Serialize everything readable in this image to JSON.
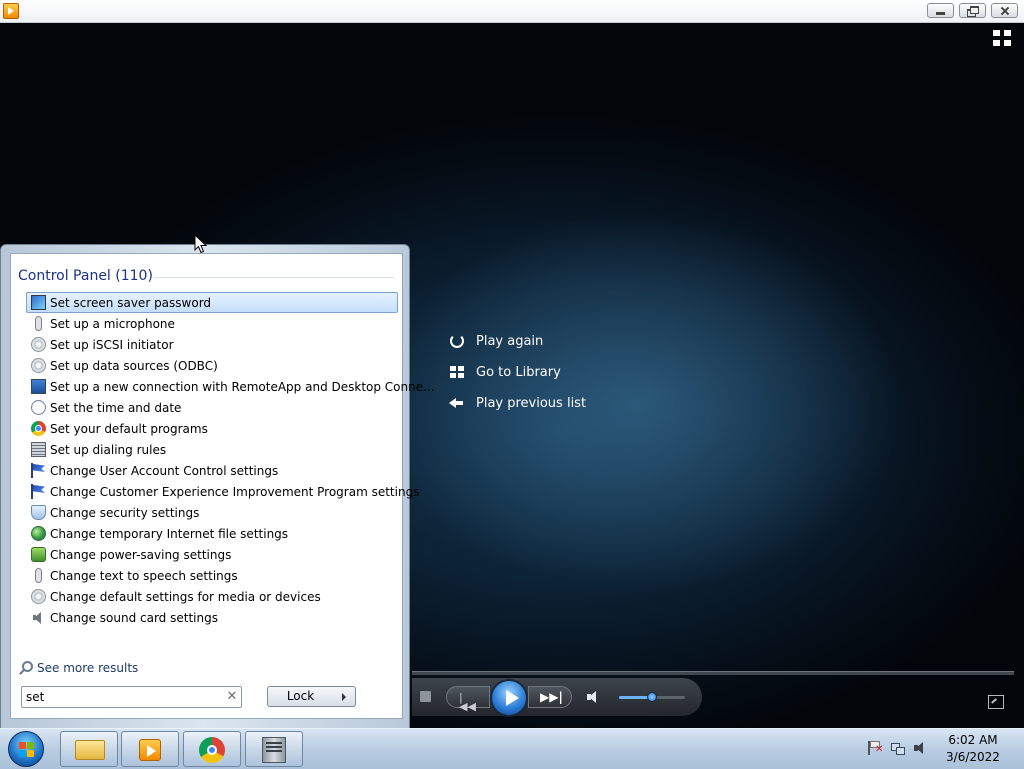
{
  "window": {
    "app_icon": "media-player-icon",
    "controls": [
      "minimize",
      "restore",
      "close"
    ]
  },
  "player": {
    "playback_options": [
      {
        "label": "Play again",
        "icon": "replay-icon"
      },
      {
        "label": "Go to Library",
        "icon": "library-icon"
      },
      {
        "label": "Play previous list",
        "icon": "back-arrow-icon"
      }
    ],
    "controls": {
      "stop": "stop-icon",
      "previous": "previous-icon",
      "play": "play-icon",
      "next": "next-icon",
      "mute": "speaker-icon",
      "volume_fraction": 0.5,
      "fullscreen": "fullscreen-icon"
    },
    "accent": "#2d7fd8"
  },
  "start_menu": {
    "section_header": "Control Panel (110)",
    "results": [
      {
        "label": "Set screen saver password",
        "icon": "monitor-icon",
        "selected": true
      },
      {
        "label": "Set up a microphone",
        "icon": "microphone-icon"
      },
      {
        "label": "Set up iSCSI initiator",
        "icon": "gear-icon"
      },
      {
        "label": "Set up data sources (ODBC)",
        "icon": "gear-icon"
      },
      {
        "label": "Set up a new connection with RemoteApp and Desktop Conne...",
        "icon": "remote-desktop-icon"
      },
      {
        "label": "Set the time and date",
        "icon": "clock-icon"
      },
      {
        "label": "Set your default programs",
        "icon": "chrome-icon"
      },
      {
        "label": "Set up dialing rules",
        "icon": "phone-icon"
      },
      {
        "label": "Change User Account Control settings",
        "icon": "flag-icon"
      },
      {
        "label": "Change Customer Experience Improvement Program settings",
        "icon": "flag-icon"
      },
      {
        "label": "Change security settings",
        "icon": "shield-icon"
      },
      {
        "label": "Change temporary Internet file settings",
        "icon": "globe-icon"
      },
      {
        "label": "Change power-saving settings",
        "icon": "power-icon"
      },
      {
        "label": "Change text to speech settings",
        "icon": "microphone-icon"
      },
      {
        "label": "Change default settings for media or devices",
        "icon": "gear-icon"
      },
      {
        "label": "Change sound card settings",
        "icon": "speaker-icon"
      }
    ],
    "see_more": "See more results",
    "search": {
      "value": "set",
      "placeholder": ""
    },
    "power_button": {
      "label": "Lock"
    }
  },
  "taskbar": {
    "pinned": [
      {
        "name": "Windows Explorer",
        "icon": "folder-icon"
      },
      {
        "name": "Windows Media Player",
        "icon": "media-player-icon"
      },
      {
        "name": "Google Chrome",
        "icon": "chrome-icon"
      },
      {
        "name": "Server Manager",
        "icon": "server-icon"
      }
    ],
    "tray": [
      "action-center-flag-icon",
      "network-icon",
      "volume-icon"
    ],
    "clock": {
      "time": "6:02 AM",
      "date": "3/6/2022"
    }
  }
}
